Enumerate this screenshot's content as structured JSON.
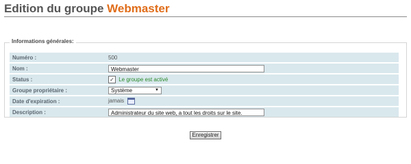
{
  "page": {
    "title_prefix": "Edition du groupe",
    "title_group": "Webmaster"
  },
  "fieldset": {
    "legend": "Informations générales:"
  },
  "fields": {
    "number": {
      "label": "Numéro :",
      "value": "500"
    },
    "name": {
      "label": "Nom :",
      "value": "Webmaster"
    },
    "status": {
      "label": "Status :",
      "checkbox_text": "Le groupe est activé",
      "checked": true,
      "check_glyph": "✓"
    },
    "owner_group": {
      "label": "Groupe propriétaire :",
      "selected": "Système",
      "arrow": "▼"
    },
    "expiration": {
      "label": "Date d'expiration :",
      "value": "jamais",
      "icon": "calendar-icon"
    },
    "description": {
      "label": "Description :",
      "value": "Administrateur du site web, a tout les droits sur le site."
    }
  },
  "actions": {
    "save_label": "Enregistrer"
  },
  "colors": {
    "accent": "#e06d1a",
    "row_background": "#d9e8ed",
    "status_text": "#2a8a2a"
  }
}
